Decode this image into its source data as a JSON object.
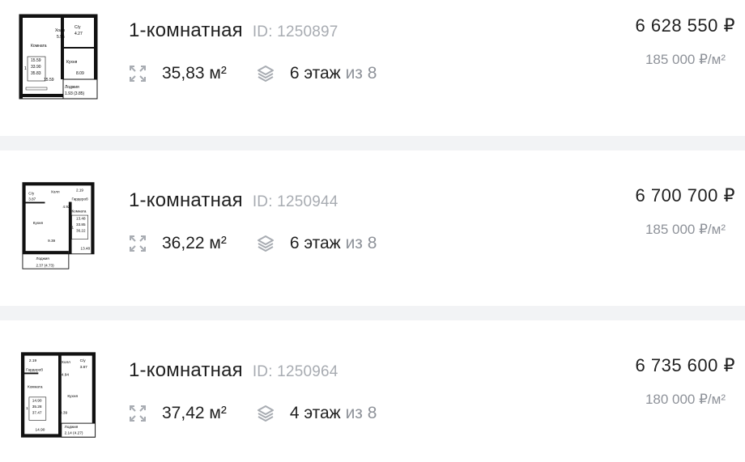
{
  "listings": [
    {
      "rooms": "1-комнатная",
      "id_label": "ID: 1250897",
      "area": "35,83 м²",
      "floor": "6 этаж",
      "floor_of": "из 8",
      "price": "6 628 550 ₽",
      "price_per_m2": "185 000 ₽/м²",
      "plan": {
        "hall": "Холл",
        "hall_area": "5.95",
        "bath": "С/у",
        "bath_area": "4.27",
        "room": "Комната",
        "room_num": "1",
        "room_a": "15.59",
        "room_b": "33.90",
        "room_c": "35.83",
        "room_side": "15.59",
        "kitchen": "Кухня",
        "kitchen_area": "8.09",
        "loggia": "Лоджия",
        "loggia_area": "1.93 (3.85)"
      }
    },
    {
      "rooms": "1-комнатная",
      "id_label": "ID: 1250944",
      "area": "36,22 м²",
      "floor": "6 этаж",
      "floor_of": "из 8",
      "price": "6 700 700 ₽",
      "price_per_m2": "185 000 ₽/м²",
      "plan": {
        "bath": "С/у",
        "bath_area": "3.87",
        "hall": "Холл",
        "hall_area": "4.92",
        "wardrobe": "Гардероб",
        "wardrobe_area": "2.19",
        "room": "Комната",
        "room_num": "1",
        "room_a": "13.48",
        "room_b": "33.85",
        "room_c": "36.22",
        "room_side": "13.48",
        "kitchen": "Кухня",
        "kitchen_area": "9.39",
        "loggia": "Лоджия",
        "loggia_area": "2.37 (4.73)"
      }
    },
    {
      "rooms": "1-комнатная",
      "id_label": "ID: 1250964",
      "area": "37,42 м²",
      "floor": "4 этаж",
      "floor_of": "из 8",
      "price": "6 735 600 ₽",
      "price_per_m2": "180 000 ₽/м²",
      "plan": {
        "wardrobe": "Гардероб",
        "wardrobe_area": "2.19",
        "hall": "Холл",
        "hall_area": "4.94",
        "bath": "С/у",
        "bath_area": "3.87",
        "room": "Комната",
        "room_num": "1",
        "room_a": "14.90",
        "room_b": "35.28",
        "room_c": "37.47",
        "room_side": "14.90",
        "kitchen": "Кухня",
        "kitchen_area": "9.39",
        "loggia": "Лоджия",
        "loggia_area": "2.14 (4.27)"
      }
    }
  ],
  "icons": {
    "area": "expand-arrows-icon",
    "floor": "layers-icon"
  },
  "colors": {
    "text": "#1f1f1f",
    "muted": "#8e9299",
    "id": "#a8acb2",
    "separator": "#f2f3f5"
  }
}
